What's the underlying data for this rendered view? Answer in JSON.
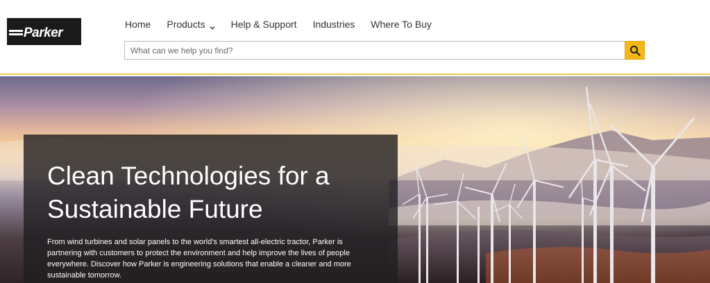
{
  "header": {
    "logo_text": "Parker",
    "nav": [
      {
        "label": "Home"
      },
      {
        "label": "Products"
      },
      {
        "label": "Help & Support"
      },
      {
        "label": "Industries"
      },
      {
        "label": "Where To Buy"
      }
    ],
    "search": {
      "placeholder": "What can we help you find?",
      "value": ""
    },
    "accent_color": "#f5b718"
  },
  "hero": {
    "title": "Clean Technologies for a Sustainable Future",
    "body": "From wind turbines and solar panels to the world's smartest all-electric tractor, Parker is partnering with customers to protect the environment and help improve the lives of people everywhere. Discover how Parker is engineering solutions that enable a cleaner and more sustainable tomorrow."
  },
  "icons": {
    "search": "search-icon",
    "products_dropdown": "chevron-down-icon",
    "logo": "parker-logo"
  }
}
